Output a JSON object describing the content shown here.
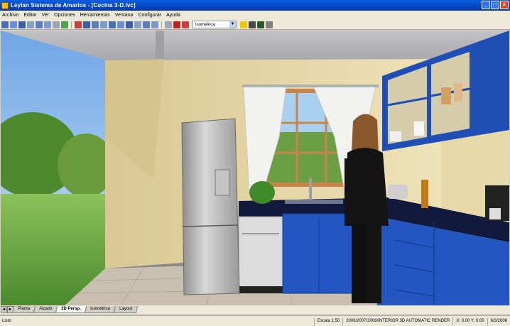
{
  "window": {
    "title": "Leylan Sistema de Amarios - [Cocina 3-D.lvc]",
    "min_label": "_",
    "max_label": "□",
    "close_label": "×"
  },
  "menubar": {
    "items": [
      "Archivo",
      "Editar",
      "Ver",
      "Opciones",
      "Herramientas",
      "Ventana",
      "Configurar",
      "Ayuda"
    ]
  },
  "toolbar": {
    "combo_value": "Isométrica",
    "combo_arrow": "▼"
  },
  "tabs": {
    "nav_first": "◄",
    "nav_next": "►",
    "items": [
      {
        "label": "Planta",
        "active": false
      },
      {
        "label": "Alzado",
        "active": false
      },
      {
        "label": "3D Persp.",
        "active": true
      },
      {
        "label": "Isométrica",
        "active": false
      },
      {
        "label": "Layout",
        "active": false
      }
    ]
  },
  "status": {
    "left": "Listo",
    "cell1": "Escala 1:50",
    "cell2": "2006/2007/2008/INTERIOR 3D  AUTOMATIC RENDER",
    "cell3": "X: 0.00  Y: 0.00",
    "cell4": "6/3/2008"
  },
  "colors": {
    "title_bar": "#0645c4",
    "cabinet_blue": "#1f4fb5",
    "wall": "#e6d6a8",
    "floor": "#c9bfae",
    "ceiling": "#b7b7b9"
  }
}
